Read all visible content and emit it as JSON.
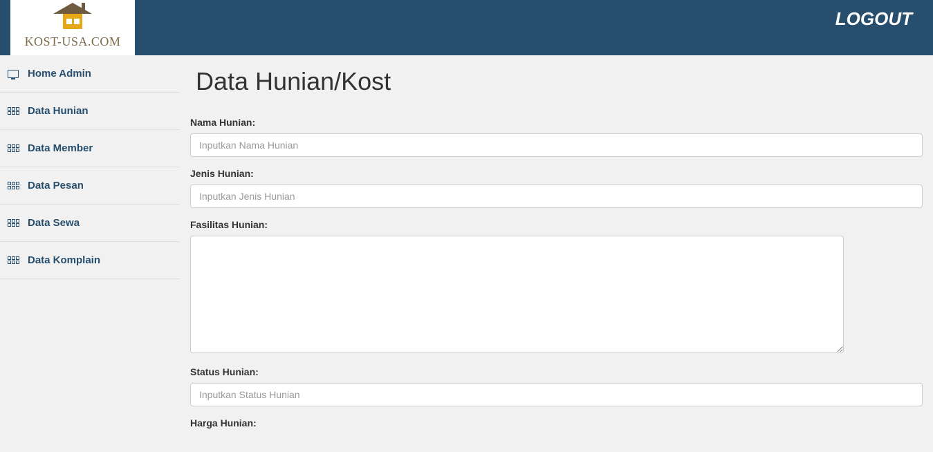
{
  "header": {
    "logo_text": "KOST-USA.COM",
    "logout_label": "LOGOUT"
  },
  "sidebar": {
    "items": [
      {
        "label": "Home Admin",
        "icon": "monitor"
      },
      {
        "label": "Data Hunian",
        "icon": "table"
      },
      {
        "label": "Data Member",
        "icon": "table"
      },
      {
        "label": "Data Pesan",
        "icon": "table"
      },
      {
        "label": "Data Sewa",
        "icon": "table"
      },
      {
        "label": "Data Komplain",
        "icon": "table"
      }
    ]
  },
  "main": {
    "title": "Data Hunian/Kost",
    "form": {
      "nama_hunian": {
        "label": "Nama Hunian:",
        "placeholder": "Inputkan Nama Hunian",
        "value": ""
      },
      "jenis_hunian": {
        "label": "Jenis Hunian:",
        "placeholder": "Inputkan Jenis Hunian",
        "value": ""
      },
      "fasilitas_hunian": {
        "label": "Fasilitas Hunian:",
        "value": ""
      },
      "status_hunian": {
        "label": "Status Hunian:",
        "placeholder": "Inputkan Status Hunian",
        "value": ""
      },
      "harga_hunian": {
        "label": "Harga Hunian:"
      }
    }
  }
}
